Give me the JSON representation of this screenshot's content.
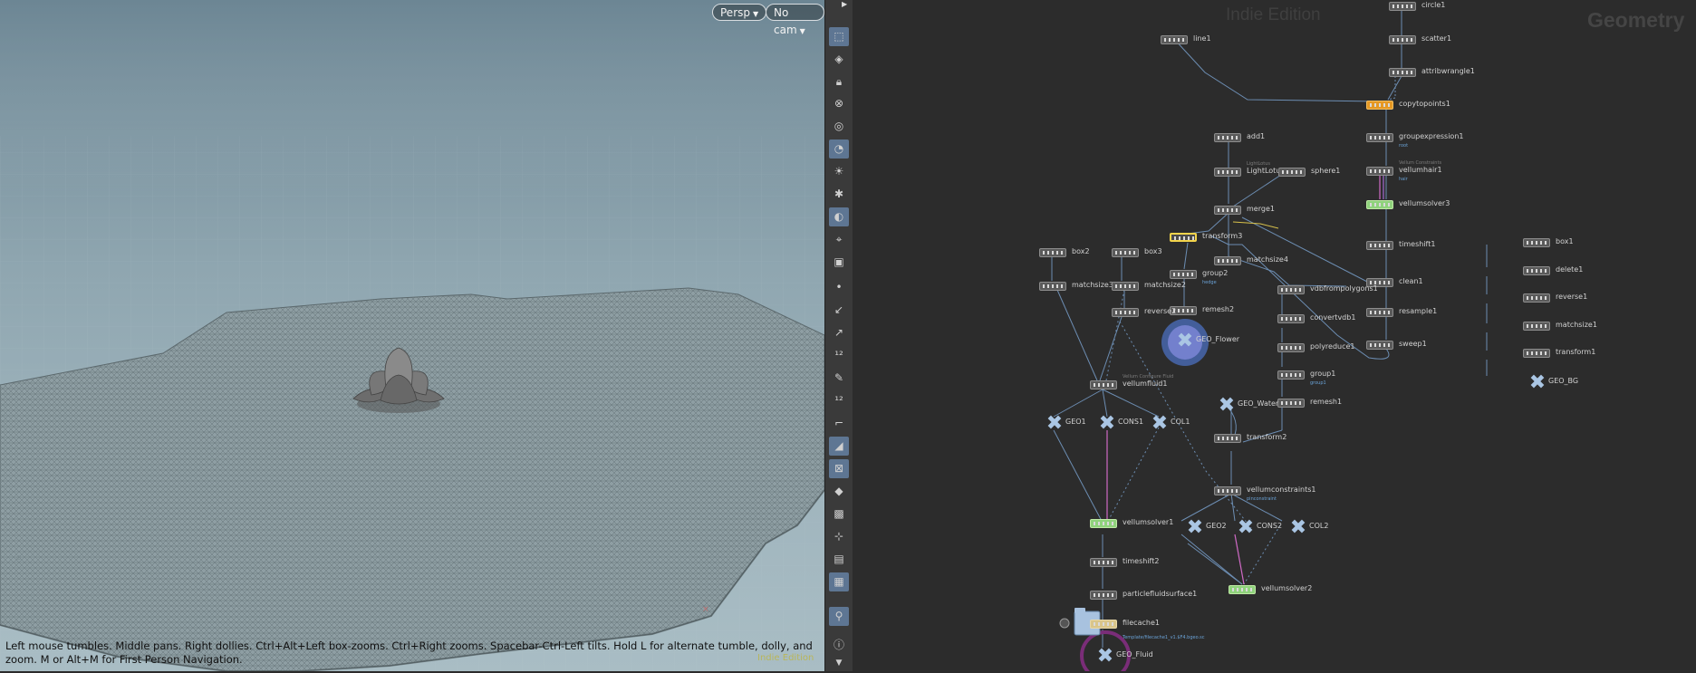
{
  "viewport": {
    "persp_label": "Persp",
    "cam_label": "No cam",
    "help_text": "Left mouse tumbles. Middle pans. Right dollies. Ctrl+Alt+Left box-zooms. Ctrl+Right zooms. Spacebar-Ctrl-Left tilts. Hold L for alternate tumble, dolly, and zoom.     M or Alt+M for First Person Navigation.",
    "watermark": "Indie Edition"
  },
  "toolbar": {
    "icons": [
      "select-icon",
      "view-icon",
      "lock-icon",
      "ghost-icon",
      "display-icon",
      "light-icon",
      "bulb-icon",
      "headlight-icon",
      "shading-icon",
      "camera-icon",
      "camera-flip-icon",
      "point-icon",
      "normal-icon",
      "vector-icon",
      "number-icon",
      "paint-icon",
      "number-icon",
      "corner-icon",
      "snap-icon",
      "grid-icon",
      "plane-icon",
      "uv-icon",
      "axis-icon",
      "frame-icon",
      "background-icon",
      "marker-icon",
      "info-icon"
    ]
  },
  "network": {
    "edition": "Indie Edition",
    "context": "Geometry",
    "nodes": [
      {
        "name": "circle1"
      },
      {
        "name": "line1"
      },
      {
        "name": "scatter1"
      },
      {
        "name": "attribwrangle1"
      },
      {
        "name": "copytopoints1"
      },
      {
        "name": "groupexpression1",
        "sub": "root"
      },
      {
        "name": "vellumhair1",
        "cmt": "Vellum Constraints",
        "sub": "hair"
      },
      {
        "name": "vellumsolver3"
      },
      {
        "name": "timeshift1"
      },
      {
        "name": "clean1"
      },
      {
        "name": "resample1"
      },
      {
        "name": "sweep1"
      },
      {
        "name": "add1"
      },
      {
        "name": "LightLotus1",
        "cmt": "LightLotus"
      },
      {
        "name": "sphere1"
      },
      {
        "name": "merge1"
      },
      {
        "name": "transform3"
      },
      {
        "name": "matchsize4"
      },
      {
        "name": "group2",
        "sub": "hedge"
      },
      {
        "name": "remesh2"
      },
      {
        "name": "vdbfrompolygons1"
      },
      {
        "name": "convertvdb1"
      },
      {
        "name": "polyreduce1"
      },
      {
        "name": "group1",
        "sub": "group1"
      },
      {
        "name": "remesh1"
      },
      {
        "name": "box2"
      },
      {
        "name": "box3"
      },
      {
        "name": "matchsize3"
      },
      {
        "name": "matchsize2"
      },
      {
        "name": "reverse2"
      },
      {
        "name": "vellumfluid1",
        "cmt": "Vellum Configure Fluid"
      },
      {
        "name": "transform2"
      },
      {
        "name": "vellumconstraints1",
        "sub": "pinconstraint"
      },
      {
        "name": "vellumsolver1"
      },
      {
        "name": "vellumsolver2"
      },
      {
        "name": "timeshift2"
      },
      {
        "name": "particlefluidsurface1"
      },
      {
        "name": "filecache1",
        "sub": "Template/filecache1_v1.$F4.bgeo.sc"
      },
      {
        "name": "box1"
      },
      {
        "name": "delete1"
      },
      {
        "name": "reverse1"
      },
      {
        "name": "matchsize1"
      },
      {
        "name": "transform1"
      }
    ],
    "objects": [
      {
        "name": "GEO_Flower"
      },
      {
        "name": "GEO_BG"
      },
      {
        "name": "GEO1"
      },
      {
        "name": "CONS1"
      },
      {
        "name": "COL1"
      },
      {
        "name": "GEO_Water"
      },
      {
        "name": "GEO2"
      },
      {
        "name": "CONS2"
      },
      {
        "name": "COL2"
      },
      {
        "name": "GEO_Fluid"
      }
    ]
  }
}
